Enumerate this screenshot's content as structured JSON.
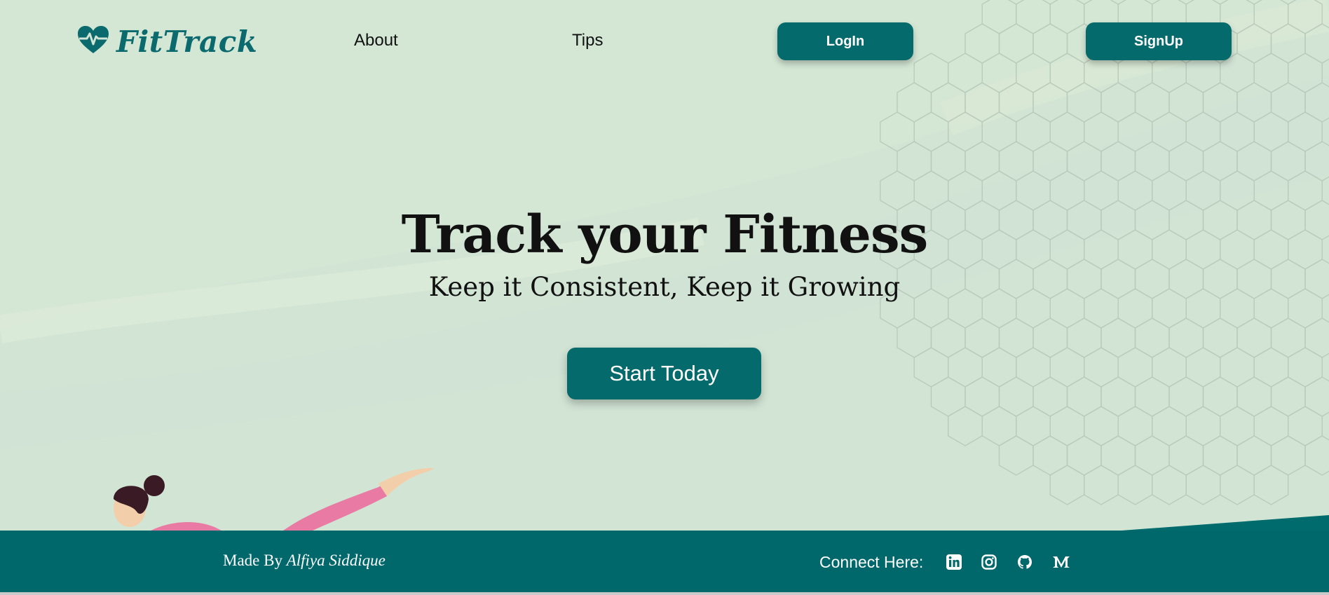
{
  "brand": {
    "name": "FitTrack",
    "icon": "heart-pulse-icon",
    "color": "#0b6a6e"
  },
  "nav": {
    "about_label": "About",
    "tips_label": "Tips",
    "login_label": "LogIn",
    "signup_label": "SignUp"
  },
  "hero": {
    "title": "Track your Fitness",
    "subtitle": "Keep it Consistent, Keep it Growing",
    "cta_label": "Start Today"
  },
  "footer": {
    "made_by_prefix": "Made By",
    "author": "Alfiya Siddique",
    "connect_label": "Connect Here:",
    "social_icons": [
      "linkedin-icon",
      "instagram-icon",
      "github-icon",
      "medium-icon"
    ]
  },
  "colors": {
    "accent": "#046a6c",
    "background": "#d2e5d5",
    "footer": "#00686b"
  }
}
